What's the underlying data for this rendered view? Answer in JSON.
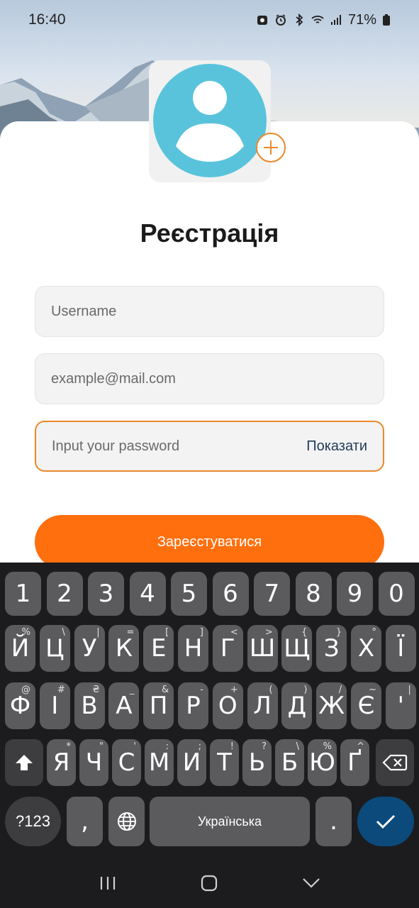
{
  "status_bar": {
    "time": "16:40",
    "battery": "71%",
    "icons": [
      "notification-icon",
      "alarm-icon",
      "bluetooth-icon",
      "wifi-icon",
      "signal-icon",
      "battery-icon"
    ]
  },
  "form": {
    "title": "Реєстрація",
    "username_placeholder": "Username",
    "email_placeholder": "example@mail.com",
    "password_placeholder": "Input your password",
    "show_label": "Показати",
    "submit_label": "Зареєстуватися"
  },
  "colors": {
    "accent": "#ff6f0e",
    "focus_border": "#e8892b",
    "avatar": "#59c3dc",
    "enter_key": "#0b4a7a"
  },
  "keyboard": {
    "number_row": [
      "1",
      "2",
      "3",
      "4",
      "5",
      "6",
      "7",
      "8",
      "9",
      "0"
    ],
    "row1": [
      {
        "k": "Й",
        "s": "%"
      },
      {
        "k": "Ц",
        "s": "\\"
      },
      {
        "k": "У",
        "s": "|"
      },
      {
        "k": "К",
        "s": "="
      },
      {
        "k": "Е",
        "s": "["
      },
      {
        "k": "Н",
        "s": "]"
      },
      {
        "k": "Г",
        "s": "<"
      },
      {
        "k": "Ш",
        "s": ">"
      },
      {
        "k": "Щ",
        "s": "{"
      },
      {
        "k": "З",
        "s": "}"
      },
      {
        "k": "Х",
        "s": "°"
      },
      {
        "k": "Ї",
        "s": ""
      }
    ],
    "row2": [
      {
        "k": "Ф",
        "s": "@"
      },
      {
        "k": "І",
        "s": "#"
      },
      {
        "k": "В",
        "s": "₴"
      },
      {
        "k": "А",
        "s": "_"
      },
      {
        "k": "П",
        "s": "&"
      },
      {
        "k": "Р",
        "s": "-"
      },
      {
        "k": "О",
        "s": "+"
      },
      {
        "k": "Л",
        "s": "("
      },
      {
        "k": "Д",
        "s": ")"
      },
      {
        "k": "Ж",
        "s": "/"
      },
      {
        "k": "Є",
        "s": "~"
      },
      {
        "k": "'",
        "s": "|"
      }
    ],
    "row3": [
      {
        "k": "Я",
        "s": "*"
      },
      {
        "k": "Ч",
        "s": "\""
      },
      {
        "k": "С",
        "s": "'"
      },
      {
        "k": "М",
        "s": ":"
      },
      {
        "k": "И",
        "s": ";"
      },
      {
        "k": "Т",
        "s": "!"
      },
      {
        "k": "Ь",
        "s": "?"
      },
      {
        "k": "Б",
        "s": "\\"
      },
      {
        "k": "Ю",
        "s": "%"
      },
      {
        "k": "Ґ",
        "s": "^"
      }
    ],
    "symbols_label": "?123",
    "comma_label": ",",
    "space_label": "Українська",
    "period_label": "."
  }
}
